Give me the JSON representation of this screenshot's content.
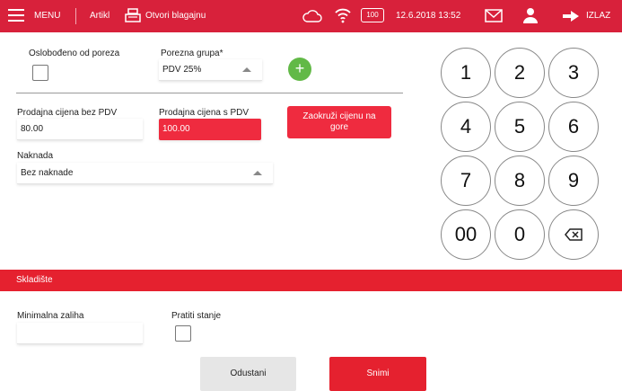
{
  "topbar": {
    "menu_label": "MENU",
    "artikl_label": "Artikl",
    "cash_label": "Otvori blagajnu",
    "battery": "100",
    "datetime": "12.6.2018 13:52",
    "logout_label": "IZLAZ"
  },
  "form": {
    "tax_free_label": "Oslobođeno od poreza",
    "tax_group_label": "Porezna grupa*",
    "tax_group_value": "PDV 25%",
    "price_without_label": "Prodajna cijena bez PDV",
    "price_without_value": "80.00",
    "price_with_label": "Prodajna cijena s PDV",
    "price_with_value": "100.00",
    "round_button": "Zaokruži cijenu na gore",
    "fee_label": "Naknada",
    "fee_value": "Bez naknade"
  },
  "keypad": [
    "1",
    "2",
    "3",
    "4",
    "5",
    "6",
    "7",
    "8",
    "9",
    "00",
    "0"
  ],
  "warehouse": {
    "section_title": "Skladište",
    "min_stock_label": "Minimalna zaliha",
    "min_stock_value": "",
    "track_stock_label": "Pratiti stanje"
  },
  "actions": {
    "cancel": "Odustani",
    "save": "Snimi"
  },
  "colors": {
    "brand_red": "#d8213b",
    "accent_green": "#62b947"
  }
}
